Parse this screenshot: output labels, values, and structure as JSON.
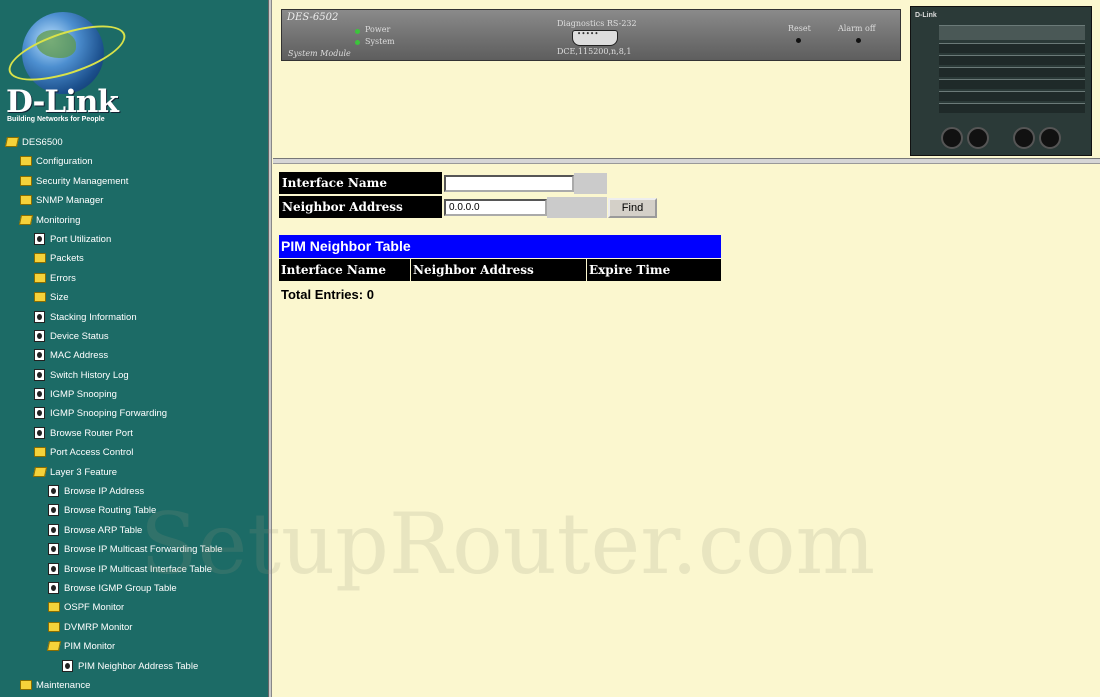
{
  "sidebar": {
    "brand": "D-Link",
    "tagline": "Building Networks for People",
    "tree": [
      {
        "label": "DES6500",
        "level": 0,
        "icon": "folder-open-icon"
      },
      {
        "label": "Configuration",
        "level": 1,
        "icon": "folder-icon"
      },
      {
        "label": "Security Management",
        "level": 1,
        "icon": "folder-icon"
      },
      {
        "label": "SNMP Manager",
        "level": 1,
        "icon": "folder-icon"
      },
      {
        "label": "Monitoring",
        "level": 1,
        "icon": "folder-open-icon"
      },
      {
        "label": "Port Utilization",
        "level": 2,
        "icon": "page-icon"
      },
      {
        "label": "Packets",
        "level": 2,
        "icon": "folder-icon"
      },
      {
        "label": "Errors",
        "level": 2,
        "icon": "folder-icon"
      },
      {
        "label": "Size",
        "level": 2,
        "icon": "folder-icon"
      },
      {
        "label": "Stacking Information",
        "level": 2,
        "icon": "page-icon"
      },
      {
        "label": "Device Status",
        "level": 2,
        "icon": "page-icon"
      },
      {
        "label": "MAC Address",
        "level": 2,
        "icon": "page-icon"
      },
      {
        "label": "Switch History Log",
        "level": 2,
        "icon": "page-icon"
      },
      {
        "label": "IGMP Snooping",
        "level": 2,
        "icon": "page-icon"
      },
      {
        "label": "IGMP Snooping Forwarding",
        "level": 2,
        "icon": "page-icon"
      },
      {
        "label": "Browse Router Port",
        "level": 2,
        "icon": "page-icon"
      },
      {
        "label": "Port Access Control",
        "level": 2,
        "icon": "folder-icon"
      },
      {
        "label": "Layer 3 Feature",
        "level": 2,
        "icon": "folder-open-icon"
      },
      {
        "label": "Browse IP Address",
        "level": 3,
        "icon": "page-icon"
      },
      {
        "label": "Browse Routing Table",
        "level": 3,
        "icon": "page-icon"
      },
      {
        "label": "Browse ARP Table",
        "level": 3,
        "icon": "page-icon"
      },
      {
        "label": "Browse IP Multicast Forwarding Table",
        "level": 3,
        "icon": "page-icon"
      },
      {
        "label": "Browse IP Multicast Interface Table",
        "level": 3,
        "icon": "page-icon"
      },
      {
        "label": "Browse IGMP Group Table",
        "level": 3,
        "icon": "page-icon"
      },
      {
        "label": "OSPF Monitor",
        "level": 3,
        "icon": "folder-icon"
      },
      {
        "label": "DVMRP Monitor",
        "level": 3,
        "icon": "folder-icon"
      },
      {
        "label": "PIM Monitor",
        "level": 3,
        "icon": "folder-open-icon"
      },
      {
        "label": "PIM Neighbor Address Table",
        "level": 4,
        "icon": "page-icon"
      },
      {
        "label": "Maintenance",
        "level": 1,
        "icon": "folder-icon"
      }
    ]
  },
  "device_panel": {
    "model": "DES-6502",
    "module": "System Module",
    "power_label": "Power",
    "system_label": "System",
    "diagnostics_label": "Diagnostics RS-232",
    "dce_label": "DCE,115200,n,8,1",
    "reset_label": "Reset",
    "alarm_label": "Alarm off",
    "chassis_brand": "D-Link",
    "led_color": "#3cc43c"
  },
  "form": {
    "interface_label": "Interface Name",
    "interface_value": "",
    "neighbor_label": "Neighbor Address",
    "neighbor_value": "0.0.0.0",
    "find_label": "Find"
  },
  "table": {
    "title": "PIM Neighbor Table",
    "columns": [
      "Interface Name",
      "Neighbor Address",
      "Expire Time"
    ],
    "rows": [],
    "total_entries": "Total Entries: 0"
  },
  "watermark": "SetupRouter.com",
  "colors": {
    "sidebar_bg": "#1c6b66",
    "page_bg": "#fbf7cf",
    "table_title_bg": "#0000ff"
  }
}
